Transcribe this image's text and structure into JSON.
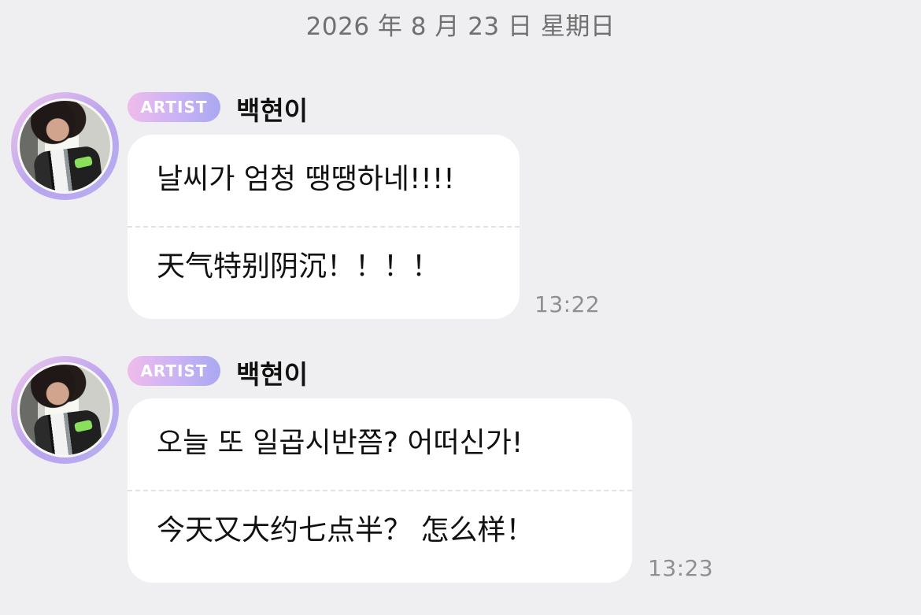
{
  "date": "2026 年 8 月 23 日  星期日",
  "messages": [
    {
      "badge": "ARTIST",
      "name": "백현이",
      "line1": "날씨가 엄청 땡땡하네!!!!",
      "line2": "天气特别阴沉！！！！",
      "time": "13:22"
    },
    {
      "badge": "ARTIST",
      "name": "백현이",
      "line1": "오늘 또 일곱시반쯤? 어떠신가!",
      "line2": "今天又大约七点半？ 怎么样！",
      "time": "13:23"
    }
  ],
  "colors": {
    "background": "#efeff1",
    "bubble": "#ffffff",
    "badge_gradient_start": "#efbcec",
    "badge_gradient_end": "#aaa8f1",
    "timestamp": "#8f8f8f"
  },
  "icons": {
    "avatar": "avatar-image"
  }
}
